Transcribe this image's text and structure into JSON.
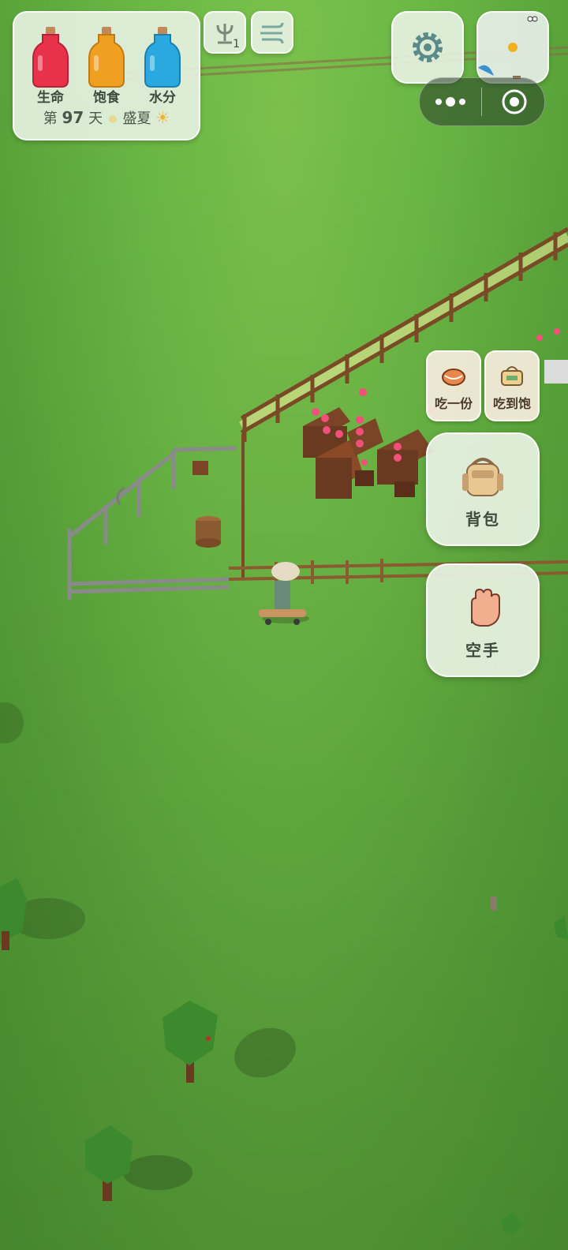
{
  "status": {
    "bottles": [
      {
        "label": "生命",
        "color": "#e8324a",
        "fill": 0.85
      },
      {
        "label": "饱食",
        "color": "#f0a020",
        "fill": 0.85
      },
      {
        "label": "水分",
        "color": "#2aa8e0",
        "fill": 0.85
      }
    ],
    "day_prefix": "第",
    "day_number": "97",
    "day_suffix": "天",
    "season": "盛夏",
    "weather_icon": "sun-icon"
  },
  "toolbar": {
    "antenna_badge": "1",
    "antenna_icon": "antenna-icon",
    "wind_icon": "wind-icon",
    "settings_icon": "gear-icon"
  },
  "capsule": {
    "more_icon": "more-dots-icon",
    "close_icon": "target-circle-icon"
  },
  "actions": {
    "eat_one": "吃一份",
    "eat_full": "吃到饱",
    "backpack": "背包",
    "empty_hand": "空手"
  },
  "colors": {
    "grass": "#6bb845",
    "panel": "#ecf4e8",
    "heart": "#f0507a"
  }
}
